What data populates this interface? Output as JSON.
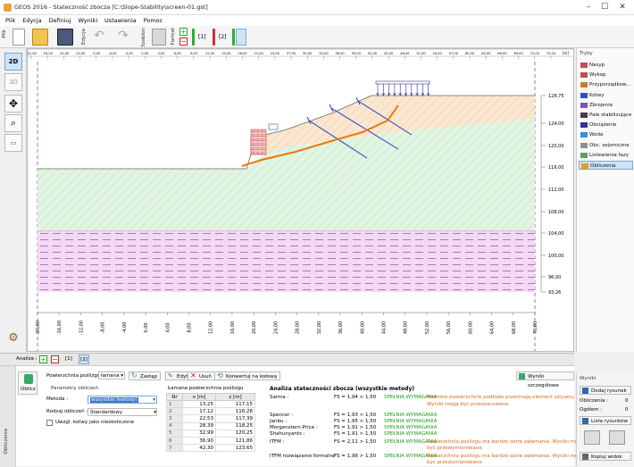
{
  "window": {
    "title": "GEOS 2016 - Stateczność zbocza [C:\\Slope-Stability\\screen-01.gst]"
  },
  "menu": [
    "Plik",
    "Edycja",
    "Definiuj",
    "Wyniki",
    "Ustawienia",
    "Pomoc"
  ],
  "toolbar": {
    "file_label": "Plik",
    "edit_label": "Edycja",
    "scheme_label": "Szablon",
    "form_label": "Format",
    "stage1": "[1]",
    "stage2": "[2]"
  },
  "leftbar": {
    "view2d": "2D",
    "view3d": "3D"
  },
  "ruler": {
    "unit": "[m]",
    "ticks": [
      "-21,00",
      "-18,00",
      "-15,00",
      "-12,00",
      "-9,00",
      "-6,00",
      "-3,00",
      "0,00",
      "3,00",
      "6,00",
      "9,00",
      "12,00",
      "15,00",
      "18,00",
      "21,00",
      "24,00",
      "27,00",
      "30,00",
      "33,00",
      "36,00",
      "39,00",
      "42,00",
      "45,00",
      "48,00",
      "51,00",
      "54,00",
      "57,00",
      "60,00",
      "63,00",
      "66,00",
      "69,00",
      "72,00",
      "75,00"
    ]
  },
  "elevations": [
    "128,75",
    "124,00",
    "120,00",
    "116,00",
    "112,00",
    "108,00",
    "104,00",
    "100,00",
    "96,00",
    "93,26"
  ],
  "xaxis": [
    "-20,00",
    "-16,00",
    "-12,00",
    "-8,00",
    "-4,00",
    "0,00",
    "4,00",
    "8,00",
    "12,00",
    "16,00",
    "20,00",
    "24,00",
    "28,00",
    "32,00",
    "36,00",
    "40,00",
    "44,00",
    "48,00",
    "52,00",
    "56,00",
    "60,00",
    "64,00",
    "68,00",
    "70,00"
  ],
  "modes": {
    "title": "Tryby",
    "items": [
      {
        "label": "Nasyp",
        "color": "#c05050"
      },
      {
        "label": "Wykop",
        "color": "#c05050"
      },
      {
        "label": "Przyporządkow...",
        "color": "#c08030"
      },
      {
        "label": "Kotwy",
        "color": "#3050c0"
      },
      {
        "label": "Zbrojenie",
        "color": "#8050c0"
      },
      {
        "label": "Pale stabilizujące",
        "color": "#404040"
      },
      {
        "label": "Obciążenie",
        "color": "#303090"
      },
      {
        "label": "Woda",
        "color": "#3090e0"
      },
      {
        "label": "Obc. sejsmiczne",
        "color": "#909090"
      },
      {
        "label": "Listewienia fazy",
        "color": "#60a060"
      },
      {
        "label": "Obliczenia",
        "color": "#e0a020"
      }
    ]
  },
  "analysis": {
    "label": "Analiza :",
    "tab1": "[1]",
    "tab2": "[2]"
  },
  "calc": {
    "side_label": "Obliczenia",
    "calc_button": "Oblicz",
    "surface_label": "Powierzchnia poślizgu :",
    "surface_value": "łamana",
    "btn_zastap": "Zastąp",
    "btn_edytuj": "Edytuj",
    "btn_usun": "Usuń",
    "btn_konwertuj": "Konwertuj na kołową",
    "btn_wyniki": "Wyniki szczegółowe",
    "params_title": "Parametry obliczeń",
    "method_label": "Metoda :",
    "method_value": "wszystkie metody)",
    "type_label": "Rodzaj obliczeń :",
    "type_value": "Standardowy",
    "anchors_label": "Uwzgl. kotwy jako nieskończone"
  },
  "polyline": {
    "title": "Łamana powierzchnia poślizgu",
    "headers": [
      "Nr",
      "x [m]",
      "z [m]"
    ],
    "rows": [
      [
        "1",
        "13,25",
        "117,15"
      ],
      [
        "2",
        "17,12",
        "116,28"
      ],
      [
        "3",
        "22,53",
        "117,39"
      ],
      [
        "4",
        "28,39",
        "118,25"
      ],
      [
        "5",
        "32,99",
        "120,25"
      ],
      [
        "6",
        "36,90",
        "121,86"
      ],
      [
        "7",
        "42,30",
        "123,65"
      ]
    ]
  },
  "results": {
    "title": "Analiza stateczności zbocza (wszystkie metody)",
    "rows": [
      {
        "name": "Sarma :",
        "fs": "FS = 1,94 > 1,50",
        "ok": "SPEŁNIA WYMAGANIA",
        "note": "Niektóre powierzchnie podziału przecinają element sztywny."
      },
      {
        "name": "",
        "fs": "",
        "ok": "",
        "note": "Wyniki mogą być przeszacowane."
      },
      {
        "name": "Spencer :",
        "fs": "FS = 1,93 > 1,50",
        "ok": "SPEŁNIA WYMAGANIA",
        "note": ""
      },
      {
        "name": "Janbu :",
        "fs": "FS = 1,95 > 1,50",
        "ok": "SPEŁNIA WYMAGANIA",
        "note": ""
      },
      {
        "name": "Morgenstern-Price :",
        "fs": "FS = 1,91 > 1,50",
        "ok": "SPEŁNIA WYMAGANIA",
        "note": ""
      },
      {
        "name": "Shahunyants :",
        "fs": "FS = 1,91 > 1,50",
        "ok": "SPEŁNIA WYMAGANIA",
        "note": ""
      },
      {
        "name": "ITFM :",
        "fs": "FS = 2,11 > 1,50",
        "ok": "SPEŁNIA WYMAGANIA",
        "note": "Powierzchnia poślizgu ma bardzo ostre załamania. Wyniki mogą"
      },
      {
        "name": "",
        "fs": "",
        "ok": "",
        "note": "być przewymiarowane."
      },
      {
        "name": "ITFM rozwiązanie formalne :",
        "fs": "FS = 1,98 > 1,50",
        "ok": "SPEŁNIA WYMAGANIA",
        "note": "Powierzchnia poślizgu ma bardzo ostre załamania. Wyniki mogą"
      },
      {
        "name": "",
        "fs": "",
        "ok": "",
        "note": "być przewymiarowane."
      }
    ]
  },
  "outputs": {
    "title": "Wyniki",
    "add_figure": "Dodaj rysunek",
    "calc_label": "Obliczenia :",
    "calc_count": "0",
    "total_label": "Ogółem :",
    "total_count": "0",
    "list_btn": "Lista rysunków",
    "copy_btn": "Kopiuj widok"
  }
}
